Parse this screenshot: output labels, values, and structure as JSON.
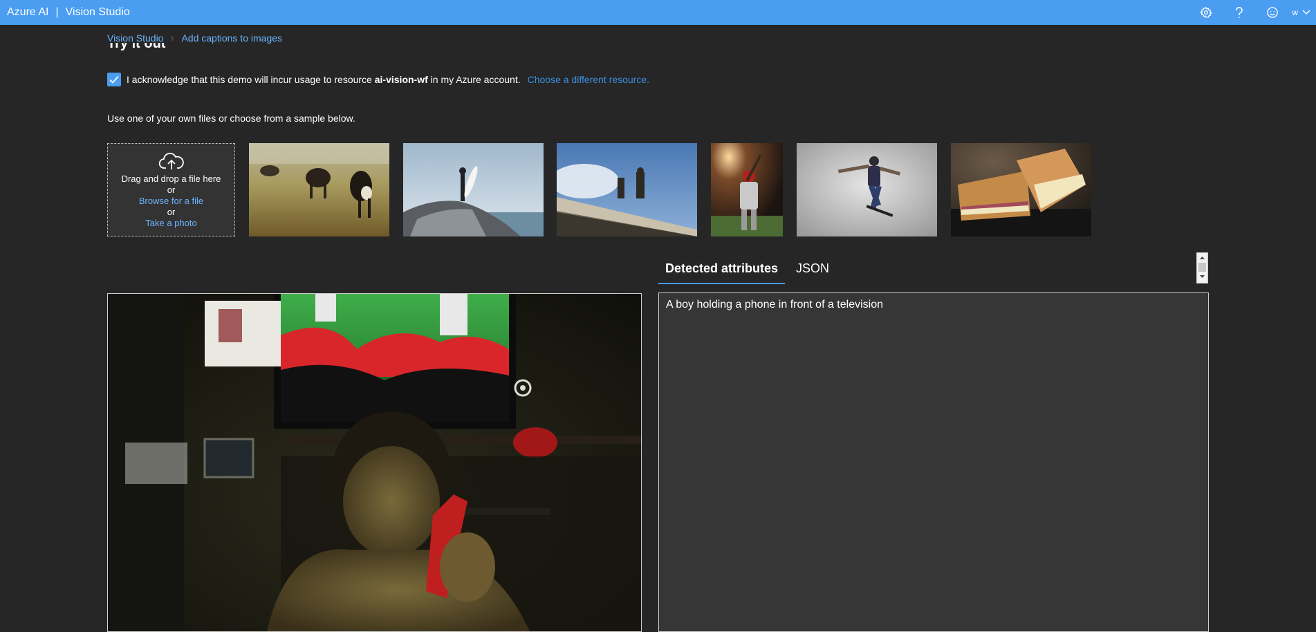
{
  "header": {
    "brand": "Azure AI",
    "separator": "|",
    "product": "Vision Studio",
    "user_initial": "w"
  },
  "breadcrumb": {
    "root": "Vision Studio",
    "current": "Add captions to images"
  },
  "section": {
    "heading": "Try it out"
  },
  "acknowledge": {
    "checked": true,
    "text_before": "I acknowledge that this demo will incur usage to resource ",
    "resource": "ai-vision-wf",
    "text_after": " in my Azure account.",
    "change_link": "Choose a different resource."
  },
  "instructions": "Use one of your own files or choose from a sample below.",
  "upload": {
    "drag_text": "Drag and drop a file here",
    "or1": "or",
    "browse": "Browse for a file",
    "or2": "or",
    "photo": "Take a photo"
  },
  "samples": [
    "cows-grazing",
    "surfer-on-rock",
    "building-statues",
    "baseball-batter",
    "skateboarder",
    "grilled-sandwich"
  ],
  "tabs": {
    "detected": "Detected attributes",
    "json": "JSON",
    "active": "detected"
  },
  "result": {
    "caption": "A boy holding a phone in front of a television"
  },
  "colors": {
    "topbar": "#4a9df0",
    "background": "#262626",
    "panel": "#363636",
    "link": "#6cb4ff",
    "accent": "#4a9df0"
  },
  "icons": [
    "settings-gear-icon",
    "help-question-icon",
    "feedback-smiley-icon",
    "chevron-down-icon",
    "checkmark-icon",
    "cloud-upload-icon",
    "chevron-right-icon"
  ]
}
